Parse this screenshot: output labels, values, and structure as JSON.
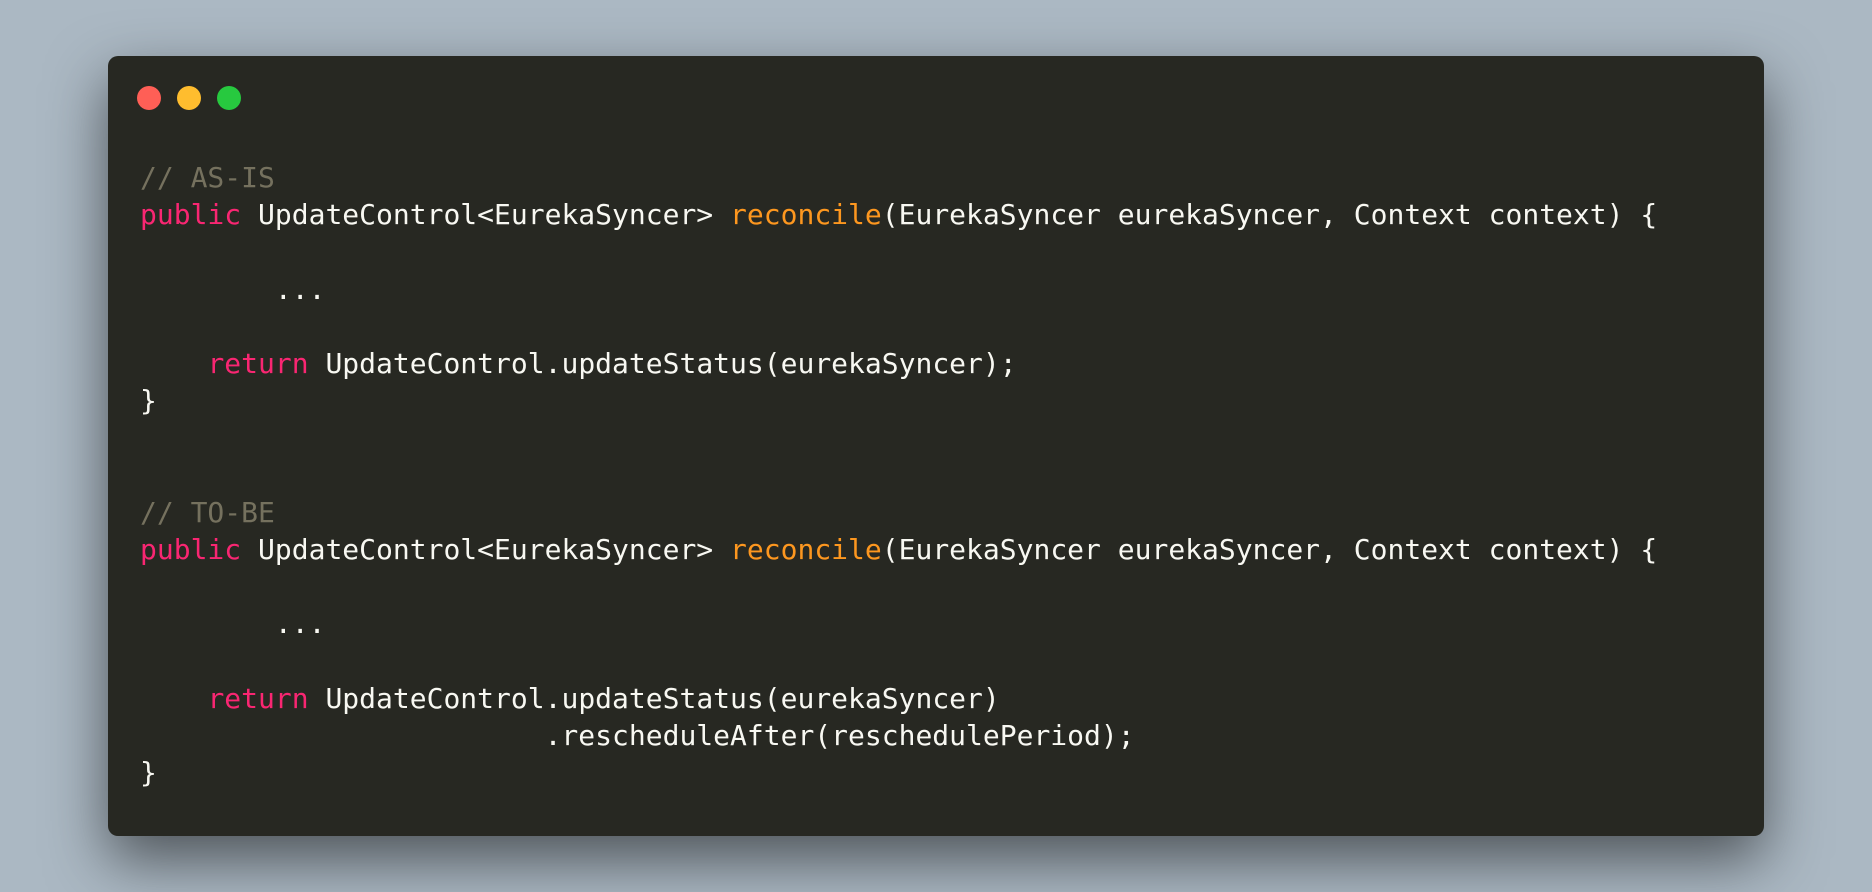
{
  "window": {
    "buttons": [
      {
        "name": "close-button",
        "color": "#ff5f56"
      },
      {
        "name": "minimize-button",
        "color": "#ffbd2e"
      },
      {
        "name": "maximize-button",
        "color": "#27c93f"
      }
    ]
  },
  "colors": {
    "background": "#abb8c3",
    "editor_background": "#272822",
    "comment": "#75715e",
    "keyword": "#f92672",
    "function": "#fd971f",
    "text": "#f8f8f2"
  },
  "code": {
    "lines": [
      [
        {
          "type": "comment",
          "text": "// AS-IS"
        }
      ],
      [
        {
          "type": "keyword",
          "text": "public"
        },
        {
          "type": "plain",
          "text": " UpdateControl<EurekaSyncer> "
        },
        {
          "type": "function",
          "text": "reconcile"
        },
        {
          "type": "plain",
          "text": "(EurekaSyncer eurekaSyncer, Context context) {"
        }
      ],
      [],
      [
        {
          "type": "plain",
          "text": "        ..."
        }
      ],
      [],
      [
        {
          "type": "plain",
          "text": "    "
        },
        {
          "type": "keyword",
          "text": "return"
        },
        {
          "type": "plain",
          "text": " UpdateControl.updateStatus(eurekaSyncer);"
        }
      ],
      [
        {
          "type": "plain",
          "text": "}"
        }
      ],
      [],
      [],
      [
        {
          "type": "comment",
          "text": "// TO-BE"
        }
      ],
      [
        {
          "type": "keyword",
          "text": "public"
        },
        {
          "type": "plain",
          "text": " UpdateControl<EurekaSyncer> "
        },
        {
          "type": "function",
          "text": "reconcile"
        },
        {
          "type": "plain",
          "text": "(EurekaSyncer eurekaSyncer, Context context) {"
        }
      ],
      [],
      [
        {
          "type": "plain",
          "text": "        ..."
        }
      ],
      [],
      [
        {
          "type": "plain",
          "text": "    "
        },
        {
          "type": "keyword",
          "text": "return"
        },
        {
          "type": "plain",
          "text": " UpdateControl.updateStatus(eurekaSyncer)"
        }
      ],
      [
        {
          "type": "plain",
          "text": "                        .rescheduleAfter(reschedulePeriod);"
        }
      ],
      [
        {
          "type": "plain",
          "text": "}"
        }
      ]
    ]
  }
}
